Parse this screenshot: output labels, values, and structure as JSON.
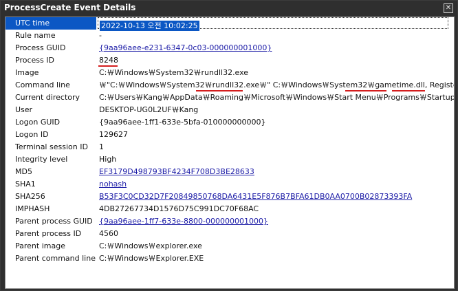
{
  "window": {
    "title": "ProcessCreate Event Details",
    "close_glyph": "✕"
  },
  "rows": [
    {
      "name": "UTC time",
      "value": "2022-10-13 오전 10:02:25",
      "type": "highlight"
    },
    {
      "name": "Rule name",
      "value": "-"
    },
    {
      "name": "Process GUID",
      "value": "{9aa96aee-e231-6347-0c03-000000001000}",
      "type": "link"
    },
    {
      "name": "Process ID",
      "value": "8248"
    },
    {
      "name": "Image",
      "value": "C:￦Windows￦System32￦rundll32.exe"
    },
    {
      "name": "Command line",
      "value": "￦\"C:￦Windows￦System32￦rundll32.exe￦\" C:￦Windows￦System32￦gametime.dll, Register"
    },
    {
      "name": "Current directory",
      "value": "C:￦Users￦Kang￦AppData￦Roaming￦Microsoft￦Windows￦Start Menu￦Programs￦Startup￦"
    },
    {
      "name": "User",
      "value": "DESKTOP-UG0L2UF￦Kang"
    },
    {
      "name": "Logon GUID",
      "value": "{9aa96aee-1ff1-633e-5bfa-010000000000}"
    },
    {
      "name": "Logon ID",
      "value": "129627"
    },
    {
      "name": "Terminal session ID",
      "value": "1"
    },
    {
      "name": "Integrity level",
      "value": "High"
    },
    {
      "name": "MD5",
      "value": "EF3179D498793BF4234F708D3BE28633",
      "type": "link"
    },
    {
      "name": "SHA1",
      "value": "nohash",
      "type": "link"
    },
    {
      "name": "SHA256",
      "value": "B53F3C0CD32D7F20849850768DA6431E5F876B7BFA61DB0AA0700B02873393FA",
      "type": "link"
    },
    {
      "name": "IMPHASH",
      "value": "4DB27267734D1576D75C991DC70F68AC"
    },
    {
      "name": "Parent process GUID",
      "value": "{9aa96aee-1ff7-633e-8800-000000001000}",
      "type": "link"
    },
    {
      "name": "Parent process ID",
      "value": "4560"
    },
    {
      "name": "Parent image",
      "value": "C:￦Windows￦explorer.exe"
    },
    {
      "name": "Parent command line",
      "value": "C:￦Windows￦Explorer.EXE"
    }
  ],
  "colors": {
    "selection": "#0b57c4",
    "link": "#1a1aa6",
    "annotation": "#d41e1e"
  }
}
